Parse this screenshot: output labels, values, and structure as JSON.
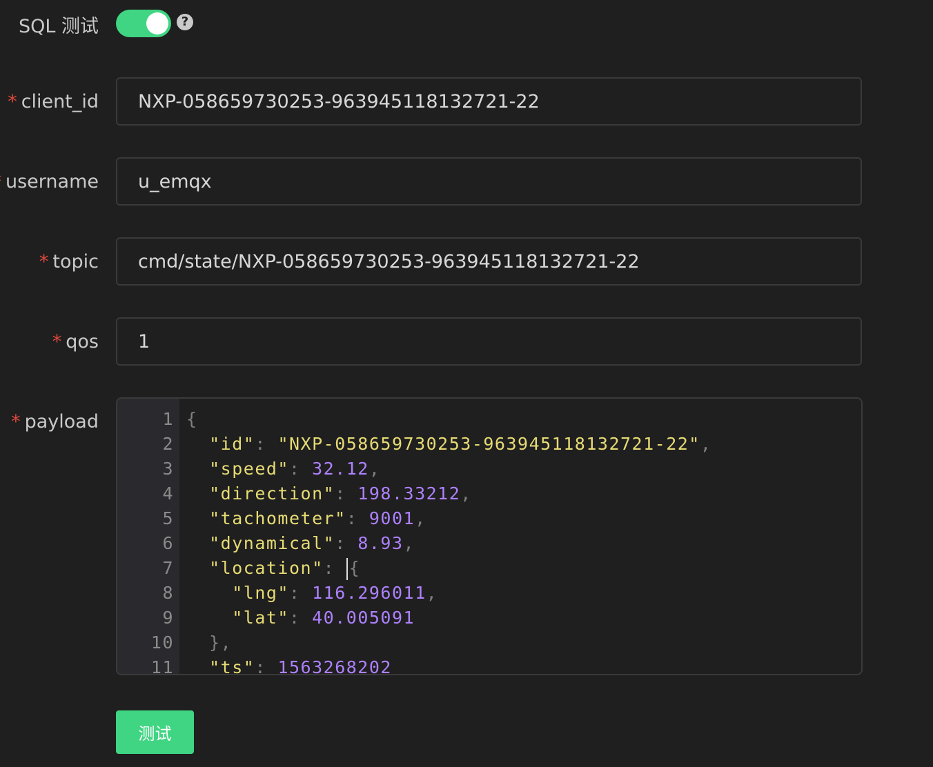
{
  "sql_test": {
    "label": "SQL 测试",
    "enabled": true,
    "help_icon": "question-circle-icon",
    "help_glyph": "?"
  },
  "form": {
    "required_mark": "*",
    "client_id": {
      "label": "client_id",
      "value": "NXP-058659730253-963945118132721-22"
    },
    "username": {
      "label": "username",
      "value": "u_emqx"
    },
    "topic": {
      "label": "topic",
      "value": "cmd/state/NXP-058659730253-963945118132721-22"
    },
    "qos": {
      "label": "qos",
      "value": "1"
    },
    "payload": {
      "label": "payload",
      "line_numbers": [
        "1",
        "2",
        "3",
        "4",
        "5",
        "6",
        "7",
        "8",
        "9",
        "10",
        "11"
      ],
      "lines": [
        "{",
        "  \"id\": \"NXP-058659730253-963945118132721-22\",",
        "  \"speed\": 32.12,",
        "  \"direction\": 198.33212,",
        "  \"tachometer\": 9001,",
        "  \"dynamical\": 8.93,",
        "  \"location\": {",
        "    \"lng\": 116.296011,",
        "    \"lat\": 40.005091",
        "  },",
        "  \"ts\": 1563268202"
      ]
    }
  },
  "actions": {
    "test_button": "测试"
  },
  "colors": {
    "background": "#1f1f1f",
    "accent": "#3fd582",
    "required": "#e0483e",
    "json_key": "#e6db74",
    "json_number": "#ae81ff"
  }
}
